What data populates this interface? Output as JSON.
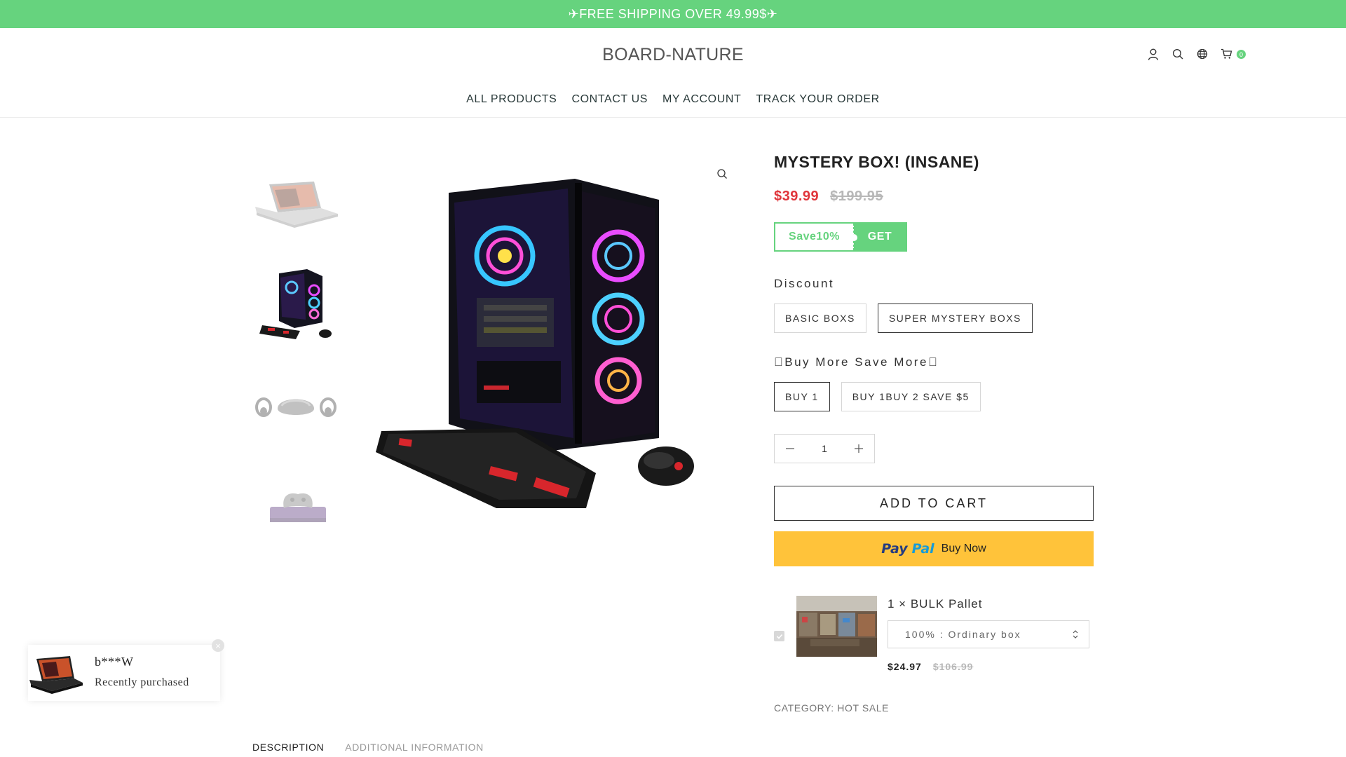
{
  "announcement": {
    "text": "✈FREE SHIPPING OVER 49.99$✈"
  },
  "header": {
    "logo": "BOARD-NATURE",
    "cart_count": "0",
    "icons": [
      "user-icon",
      "search-icon",
      "globe-icon",
      "cart-icon"
    ]
  },
  "nav": {
    "items": [
      "ALL PRODUCTS",
      "CONTACT US",
      "MY ACCOUNT",
      "TRACK YOUR ORDER"
    ]
  },
  "gallery": {
    "thumbnails": [
      "laptop",
      "gaming-pc",
      "vr-headset",
      "game-console"
    ],
    "selected_thumbnail": "gaming-pc"
  },
  "product": {
    "title": "MYSTERY BOX! (INSANE)",
    "price": "$39.99",
    "compare_price": "$199.95",
    "coupon": {
      "label": "Save10%",
      "action": "GET"
    },
    "option_discount": {
      "label": "Discount",
      "values": [
        "BASIC BOXS",
        "SUPER MYSTERY BOXS"
      ],
      "selected": "SUPER MYSTERY BOXS"
    },
    "option_bundle": {
      "label": "Buy More Save More",
      "values": [
        "BUY 1",
        "BUY 1BUY 2 SAVE $5"
      ],
      "selected": "BUY 1"
    },
    "quantity": "1",
    "add_to_cart": "ADD TO CART",
    "paypal": {
      "brand_pay": "Pay",
      "brand_pal": "Pal",
      "label": "Buy Now"
    },
    "upsell": {
      "title": "1 × BULK Pallet",
      "select_value": "100% : Ordinary box",
      "price": "$24.97",
      "compare_price": "$106.99"
    },
    "category_label": "CATEGORY:",
    "category_value": "HOT SALE"
  },
  "tabs": {
    "description": "DESCRIPTION",
    "additional": "ADDITIONAL INFORMATION"
  },
  "popup": {
    "name": "b***W",
    "text": "Recently purchased",
    "close": "×"
  },
  "colors": {
    "brand_green": "#66d37e",
    "sale_red": "#e0353b",
    "paypal_yellow": "#ffc33a"
  }
}
